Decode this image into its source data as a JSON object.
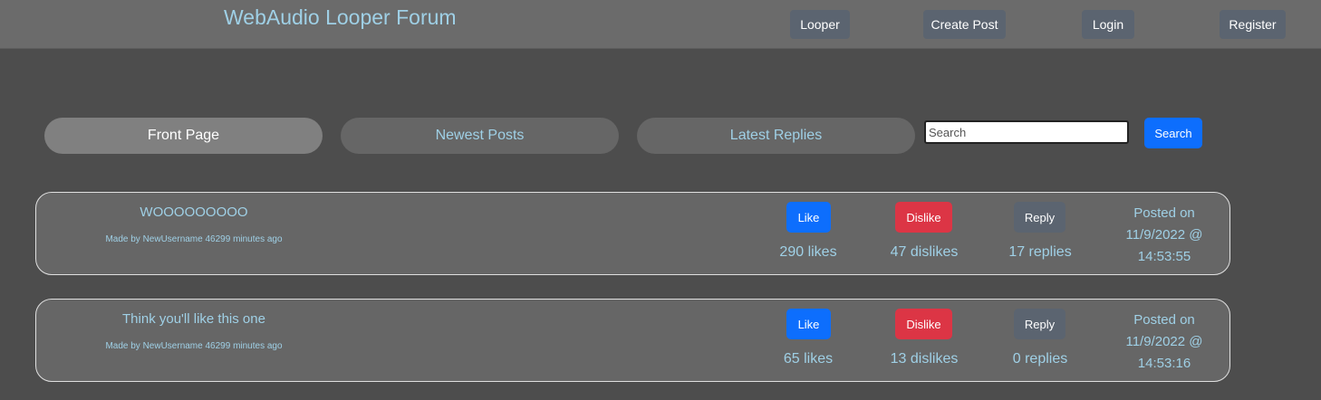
{
  "header": {
    "brand": "WebAudio Looper Forum",
    "nav": {
      "looper": "Looper",
      "create_post": "Create Post",
      "login": "Login",
      "register": "Register"
    }
  },
  "tabs": {
    "front_page": "Front Page",
    "newest_posts": "Newest Posts",
    "latest_replies": "Latest Replies"
  },
  "search": {
    "placeholder": "Search",
    "value": "",
    "button": "Search"
  },
  "posts": [
    {
      "title": "WOOOOOOOOO",
      "meta": "Made by NewUsername 46299 minutes ago",
      "like_label": "Like",
      "dislike_label": "Dislike",
      "reply_label": "Reply",
      "likes": "290 likes",
      "dislikes": "47 dislikes",
      "replies": "17 replies",
      "posted_line1": "Posted on",
      "posted_line2": "11/9/2022 @",
      "posted_line3": "14:53:55"
    },
    {
      "title": "Think you'll like this one",
      "meta": "Made by NewUsername 46299 minutes ago",
      "like_label": "Like",
      "dislike_label": "Dislike",
      "reply_label": "Reply",
      "likes": "65 likes",
      "dislikes": "13 dislikes",
      "replies": "0 replies",
      "posted_line1": "Posted on",
      "posted_line2": "11/9/2022 @",
      "posted_line3": "14:53:16"
    }
  ],
  "colors": {
    "background": "#4d4d4d",
    "navbar": "#6b6b6b",
    "accent_text": "#9fd0e6",
    "like": "#0d6efd",
    "dislike": "#dc3545",
    "secondary": "#5b6470"
  }
}
